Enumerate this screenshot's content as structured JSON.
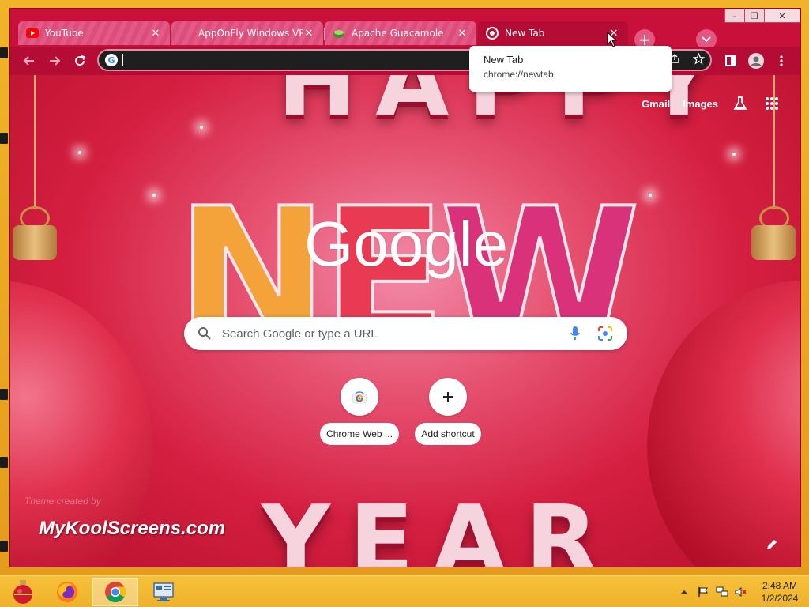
{
  "window": {
    "caption": {
      "minimize": "–",
      "maximize": "❐",
      "close": "✕"
    }
  },
  "tabs": [
    {
      "title": "YouTube",
      "icon": "youtube-icon",
      "active": false
    },
    {
      "title": "AppOnFly Windows VPS",
      "icon": "apponfly-icon",
      "active": false
    },
    {
      "title": "Apache Guacamole",
      "icon": "guacamole-icon",
      "active": false
    },
    {
      "title": "New Tab",
      "icon": "chrome-icon",
      "active": true
    }
  ],
  "tab_close": "✕",
  "toolbar": {
    "omnibox_value": ""
  },
  "tooltip": {
    "title": "New Tab",
    "url": "chrome://newtab"
  },
  "ntp": {
    "links": {
      "gmail": "Gmail",
      "images": "Images"
    },
    "logo": "Google",
    "search_placeholder": "Search Google or type a URL",
    "shortcuts": [
      {
        "label": "Chrome Web ...",
        "icon": "chrome-web-store-icon"
      },
      {
        "label": "Add shortcut",
        "icon": "plus-icon"
      }
    ],
    "theme_credit": "Theme created by",
    "watermark": "MyKoolScreens.com"
  },
  "taskbar": {
    "time": "2:48 AM",
    "date": "1/2/2024"
  },
  "colors": {
    "window_frame": "#c8103a",
    "toolbar": "#b50c35",
    "tab_inactive": "#e35a86",
    "taskbar": "#f7c13b"
  }
}
